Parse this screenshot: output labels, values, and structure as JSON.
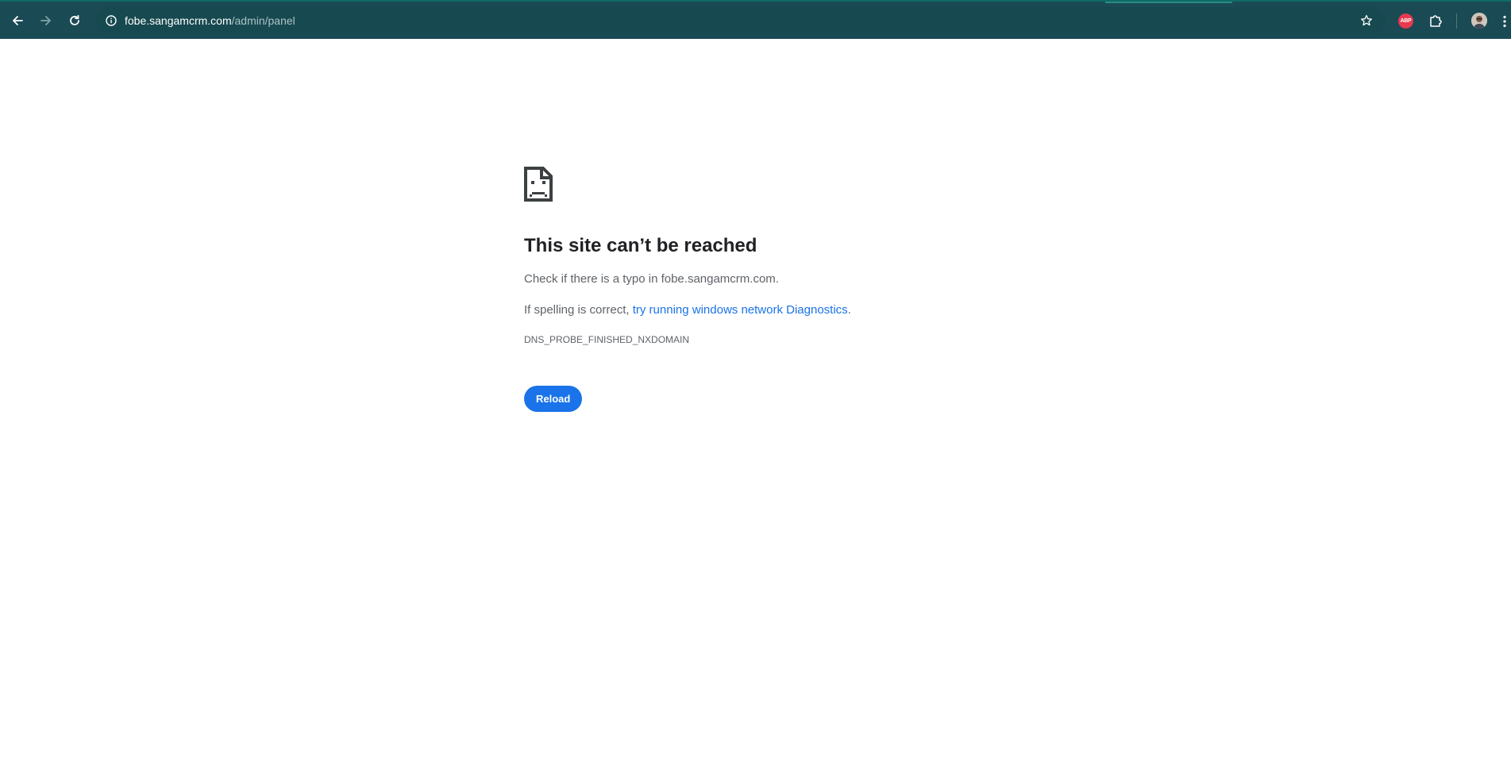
{
  "browser": {
    "url_host": "fobe.sangamcrm.com",
    "url_path": "/admin/panel",
    "extension_badge": "ABP",
    "icons": {
      "back": "back-arrow-icon",
      "forward": "forward-arrow-icon",
      "reload": "reload-icon",
      "site_info": "info-icon",
      "bookmark": "star-icon",
      "extensions": "puzzle-icon",
      "menu": "kebab-menu-icon"
    }
  },
  "error": {
    "title": "This site can’t be reached",
    "line1": "Check if there is a typo in fobe.sangamcrm.com.",
    "line2_prefix": "If spelling is correct, ",
    "line2_link": "try running windows network Diagnostics",
    "line2_suffix": ".",
    "code": "DNS_PROBE_FINISHED_NXDOMAIN",
    "reload_label": "Reload"
  },
  "colors": {
    "toolbar": "#1a4a54",
    "accent": "#1a73e8",
    "abp_badge": "#e53a4f"
  }
}
